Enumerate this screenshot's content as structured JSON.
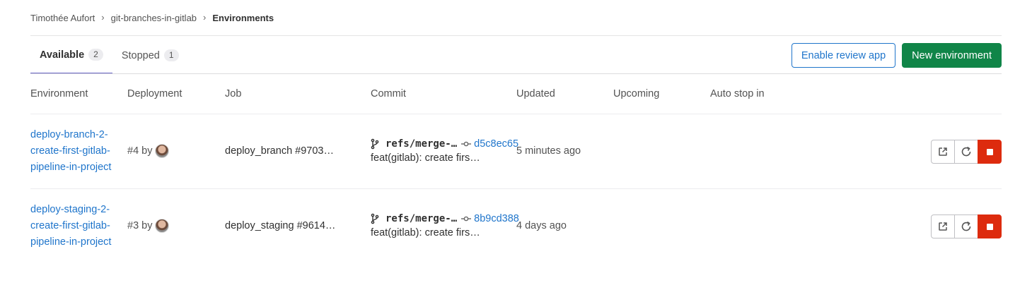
{
  "breadcrumb": {
    "user": "Timothée Aufort",
    "project": "git-branches-in-gitlab",
    "page": "Environments"
  },
  "tabs": [
    {
      "label": "Available",
      "count": "2",
      "active": true
    },
    {
      "label": "Stopped",
      "count": "1",
      "active": false
    }
  ],
  "actions": {
    "review_app": "Enable review app",
    "new_environment": "New environment"
  },
  "table": {
    "headers": {
      "environment": "Environment",
      "deployment": "Deployment",
      "job": "Job",
      "commit": "Commit",
      "updated": "Updated",
      "upcoming": "Upcoming",
      "auto_stop": "Auto stop in"
    },
    "rows": [
      {
        "name_lines": [
          "deploy-branch-2-",
          "create-first-gitlab-",
          "pipeline-in-project"
        ],
        "deployment": "#4 by",
        "job": "deploy_branch #9703…",
        "ref": "refs/merge-…",
        "sha": "d5c8ec65",
        "message": "feat(gitlab): create firs…",
        "updated": "5 minutes ago"
      },
      {
        "name_lines": [
          "deploy-staging-2-",
          "create-first-gitlab-",
          "pipeline-in-project"
        ],
        "deployment": "#3 by",
        "job": "deploy_staging #9614…",
        "ref": "refs/merge-…",
        "sha": "8b9cd388",
        "message": "feat(gitlab): create firs…",
        "updated": "4 days ago"
      }
    ]
  },
  "icons": {
    "branch": "branch-icon",
    "commit": "commit-icon",
    "external": "external-link-icon",
    "redeploy": "retry-icon",
    "stop": "stop-icon"
  },
  "colors": {
    "link": "#1f75cb",
    "primary": "#108548",
    "danger": "#dd2b0e",
    "tab_active": "#6b67c7"
  }
}
